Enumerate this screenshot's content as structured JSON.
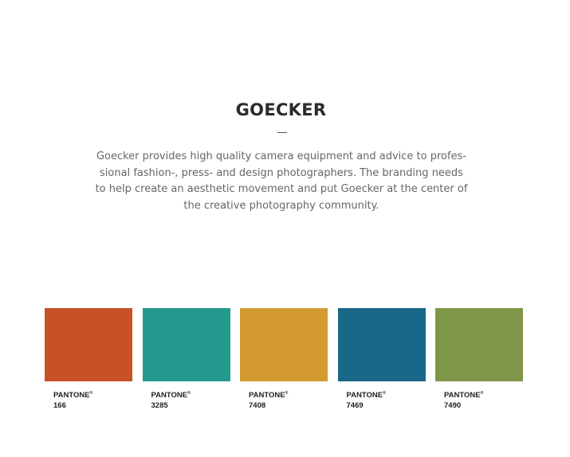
{
  "header": {
    "title": "GOECKER",
    "description_lines": [
      "Goecker provides high quality camera equipment and advice to profes-",
      "sional fashion-, press- and design photographers. The branding needs",
      "to help create an aesthetic movement and put Goecker at the center of",
      "the creative photography community."
    ]
  },
  "palette": {
    "brand_label": "PANTONE",
    "registered_mark": "®",
    "swatches": [
      {
        "code": "166",
        "color": "#c95126"
      },
      {
        "code": "3285",
        "color": "#249a8f"
      },
      {
        "code": "7408",
        "color": "#d39a30"
      },
      {
        "code": "7469",
        "color": "#196789"
      },
      {
        "code": "7490",
        "color": "#7f9547"
      }
    ]
  }
}
